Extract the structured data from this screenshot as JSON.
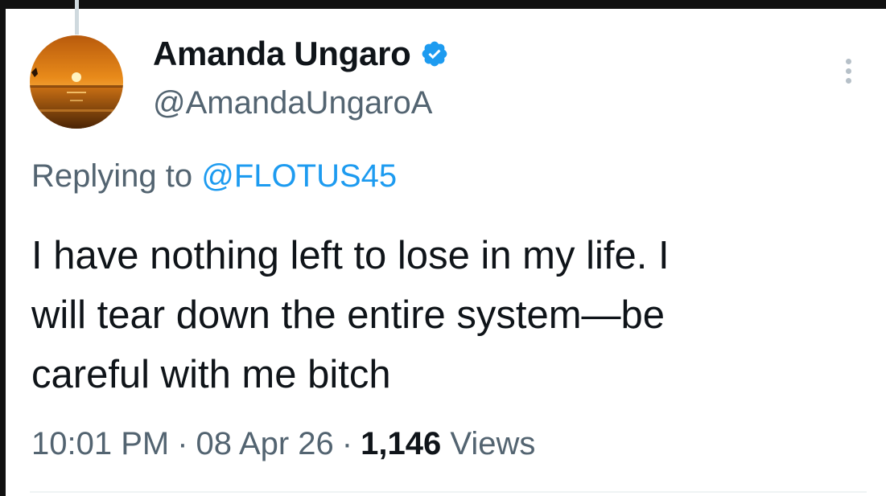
{
  "tweet": {
    "author": {
      "display_name": "Amanda Ungaro",
      "handle": "@AmandaUngaroA",
      "verified": true,
      "avatar_icon": "sunset-avatar"
    },
    "reply": {
      "prefix": "Replying to",
      "mention": "@FLOTUS45"
    },
    "text": "I have nothing left to lose in my life. I\nwill tear down the entire system—be\ncareful with me bitch",
    "meta": {
      "time": "10:01 PM",
      "separator": "·",
      "date": "08 Apr 26",
      "views_count": "1,146",
      "views_label": "Views"
    },
    "more_icon": "more-options-icon"
  },
  "colors": {
    "primary_text": "#0f1419",
    "secondary_text": "#536471",
    "link": "#1d9bf0",
    "verified_badge": "#1d9bf0",
    "background": "#ffffff"
  }
}
